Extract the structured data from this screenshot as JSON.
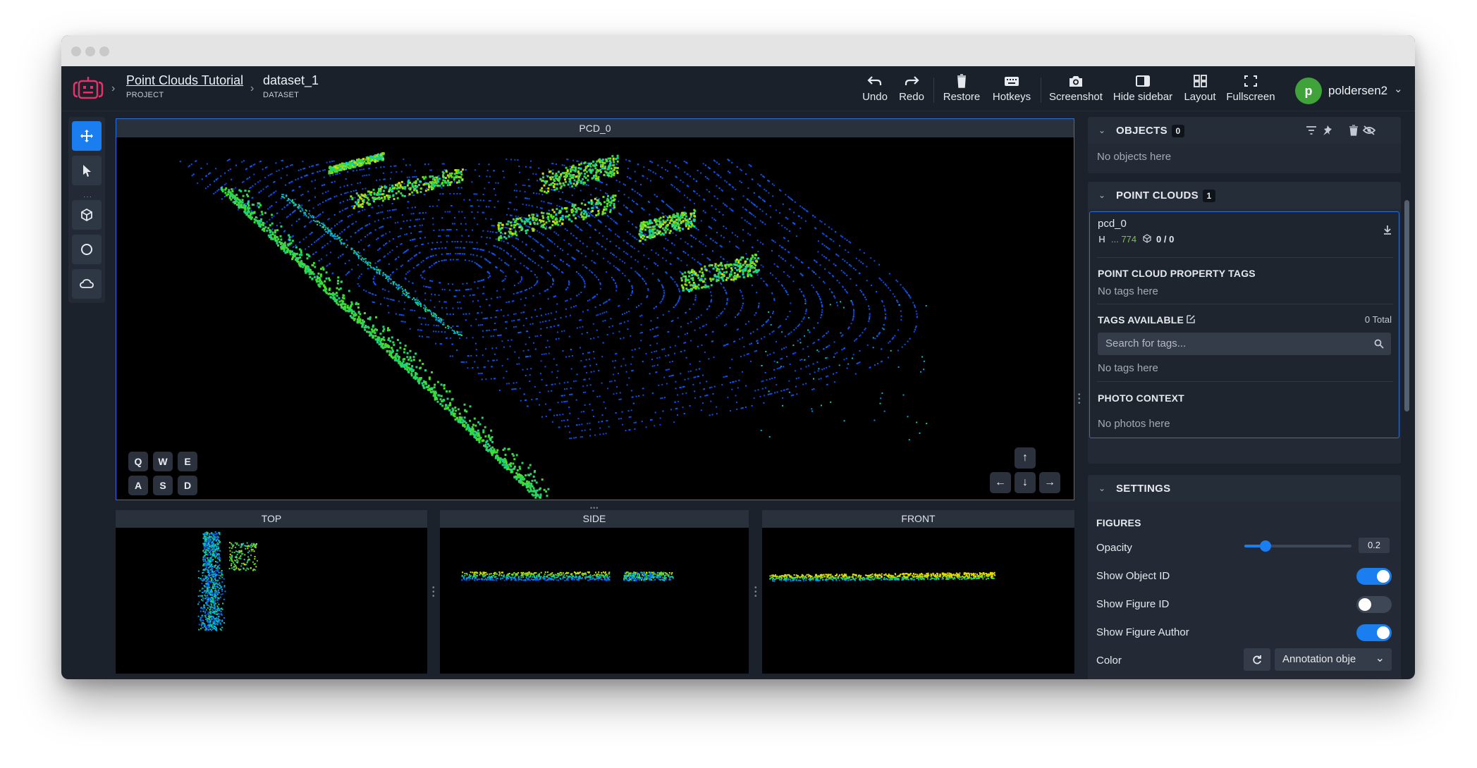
{
  "window": {
    "traffic_lights": [
      "close",
      "minimize",
      "maximize"
    ]
  },
  "breadcrumb": {
    "project": {
      "title": "Point Clouds Tutorial",
      "subtitle": "PROJECT"
    },
    "dataset": {
      "title": "dataset_1",
      "subtitle": "DATASET"
    }
  },
  "toolbar": {
    "undo": "Undo",
    "redo": "Redo",
    "restore": "Restore",
    "hotkeys": "Hotkeys",
    "screenshot": "Screenshot",
    "hide_sidebar": "Hide sidebar",
    "layout": "Layout",
    "fullscreen": "Fullscreen"
  },
  "user": {
    "initial": "p",
    "name": "poldersen2"
  },
  "tools": [
    "move-icon",
    "pointer-icon",
    "cuboid-icon",
    "circle-icon",
    "cloud-icon"
  ],
  "viewport": {
    "main_title": "PCD_0",
    "keys_top": [
      "Q",
      "W",
      "E"
    ],
    "keys_bottom": [
      "A",
      "S",
      "D"
    ],
    "arrows": {
      "up": "↑",
      "left": "←",
      "down": "↓",
      "right": "→"
    },
    "views": {
      "top": "TOP",
      "side": "SIDE",
      "front": "FRONT"
    }
  },
  "objects_panel": {
    "title": "OBJECTS",
    "count": "0",
    "empty": "No objects here"
  },
  "pointclouds_panel": {
    "title": "POINT CLOUDS",
    "count": "1",
    "item": {
      "name": "pcd_0",
      "index": "... 774",
      "figures": "0 / 0"
    },
    "property_tags": {
      "title": "POINT CLOUD PROPERTY TAGS",
      "empty": "No tags here"
    },
    "tags_available": {
      "title": "TAGS AVAILABLE",
      "total": "0 Total",
      "search_placeholder": "Search for tags...",
      "empty": "No tags here"
    },
    "photo_context": {
      "title": "PHOTO CONTEXT",
      "empty": "No photos here"
    }
  },
  "settings": {
    "title": "SETTINGS",
    "figures_title": "FIGURES",
    "opacity": {
      "label": "Opacity",
      "value": "0.2",
      "fraction": 0.2
    },
    "show_object_id": {
      "label": "Show Object ID",
      "on": true
    },
    "show_figure_id": {
      "label": "Show Figure ID",
      "on": false
    },
    "show_figure_author": {
      "label": "Show Figure Author",
      "on": true
    },
    "color": {
      "label": "Color",
      "select": "Annotation obje"
    }
  },
  "colors": {
    "accent": "#1a7df0",
    "avatar": "#3fa33a",
    "topbar": "#1a212b",
    "panel": "#232a35"
  }
}
